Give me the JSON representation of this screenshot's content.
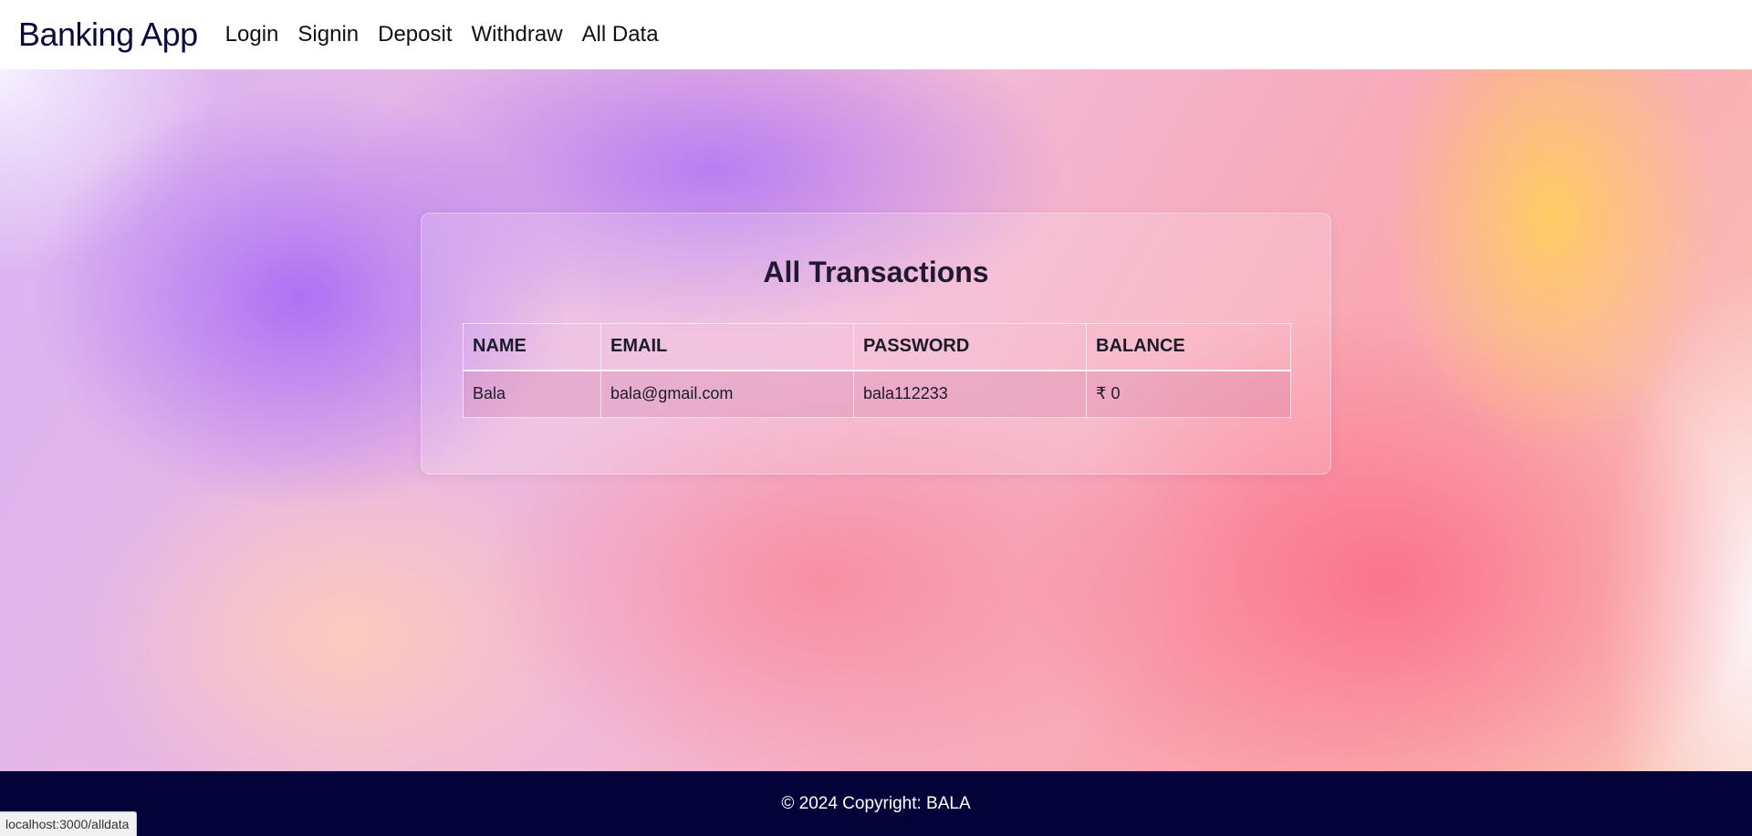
{
  "navbar": {
    "brand": "Banking App",
    "links": [
      "Login",
      "Signin",
      "Deposit",
      "Withdraw",
      "All Data"
    ]
  },
  "main": {
    "title": "All Transactions",
    "table": {
      "headers": [
        "NAME",
        "EMAIL",
        "PASSWORD",
        "BALANCE"
      ],
      "rows": [
        [
          "Bala",
          "bala@gmail.com",
          "bala112233",
          "₹ 0"
        ]
      ]
    }
  },
  "footer": {
    "text": "© 2024 Copyright: BALA"
  },
  "status_bar": {
    "url": "localhost:3000/alldata"
  },
  "colors": {
    "navbar_bg": "#ffffff",
    "brand": "#0b0b3b",
    "footer_bg": "#03033a"
  }
}
